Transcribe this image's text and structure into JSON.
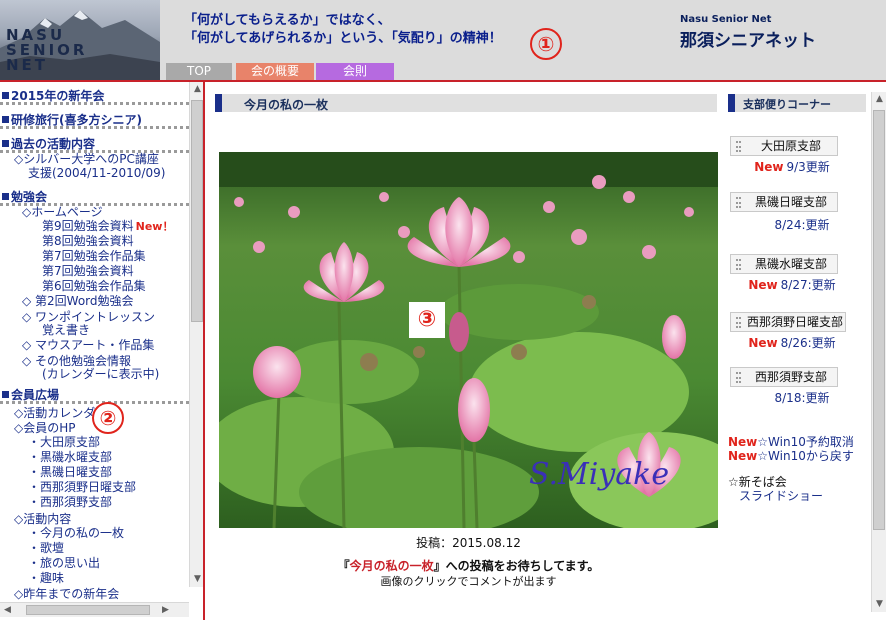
{
  "header": {
    "logo_lines": [
      "NASU",
      "SENIOR",
      "NET"
    ],
    "slogan_line1": "「何がしてもらえるか」ではなく、",
    "slogan_line2": "「何がしてあげられるか」という、「気配り」の精神！",
    "annotation_1": "①",
    "site_name_en": "Nasu Senior Net",
    "site_name_jp": "那須シニアネット",
    "tabs": [
      {
        "label": "TOP",
        "color": "#a9a9a9"
      },
      {
        "label": "会の概要",
        "color": "#e8836a"
      },
      {
        "label": "会則",
        "color": "#b66ae0"
      }
    ]
  },
  "sidebar": {
    "sections": [
      {
        "label": "2015年の新年会"
      },
      {
        "label": "研修旅行(喜多方シニア)"
      },
      {
        "label": "過去の活動内容"
      },
      {
        "label": "勉強会"
      },
      {
        "label": "会員広場"
      }
    ],
    "past_activities": {
      "silver_line1": "◇シルバー大学へのPC講座",
      "silver_line2": "支援(2004/11-2010/09)"
    },
    "study": {
      "homepage": "◇ホームページ",
      "items": [
        "第9回勉強会資料",
        "第8回勉強会資料",
        "第7回勉強会作品集",
        "第7回勉強会資料",
        "第6回勉強会作品集"
      ],
      "new_label": "New！",
      "word": "◇ 第2回Word勉強会",
      "onepoint_line1": "◇ ワンポイントレッスン",
      "onepoint_line2": "覚え書き",
      "mouseart": "◇ マウスアート・作品集",
      "other_line1": "◇ その他勉強会情報",
      "other_line2": "(カレンダーに表示中)"
    },
    "members": {
      "calendar": "◇活動カレンダー",
      "hp": "◇会員のHP",
      "branches": [
        "・大田原支部",
        "・黒磯水曜支部",
        "・黒磯日曜支部",
        "・西那須野日曜支部",
        "・西那須野支部"
      ],
      "activities": "◇活動内容",
      "activity_items": [
        "・今月の私の一枚",
        "・歌壇",
        "・旅の思い出",
        "・趣味"
      ],
      "past_newyear": "◇昨年までの新年会"
    },
    "annotation_2": "②"
  },
  "main": {
    "title": "今月の私の一枚",
    "annotation_3": "③",
    "signature": "S.Miyake",
    "post_date": "投稿：2015.08.12",
    "invite_prefix": "『",
    "invite_highlight": "今月の私の一枚",
    "invite_suffix": "』への投稿をお待ちしてます。",
    "comment_note": "画像のクリックでコメントが出ます"
  },
  "branch_corner": {
    "title": "支部便りコーナー",
    "new_label": "New",
    "branches": [
      {
        "name": "大田原支部",
        "is_new": true,
        "updated": "9/3更新"
      },
      {
        "name": "黒磯日曜支部",
        "is_new": false,
        "updated": "8/24:更新"
      },
      {
        "name": "黒磯水曜支部",
        "is_new": true,
        "updated": "8/27:更新"
      },
      {
        "name": "西那須野日曜支部",
        "is_new": true,
        "updated": "8/26:更新"
      },
      {
        "name": "西那須野支部",
        "is_new": false,
        "updated": "8/18:更新"
      }
    ],
    "win10_cancel": "☆Win10予約取消",
    "win10_revert": "☆Win10から戻す",
    "soba_line1": "☆新そば会",
    "soba_line2": "スライドショー"
  },
  "colors": {
    "accent_red": "#c8222a",
    "link_blue": "#1a2f8a",
    "new_red": "#e0241c"
  }
}
